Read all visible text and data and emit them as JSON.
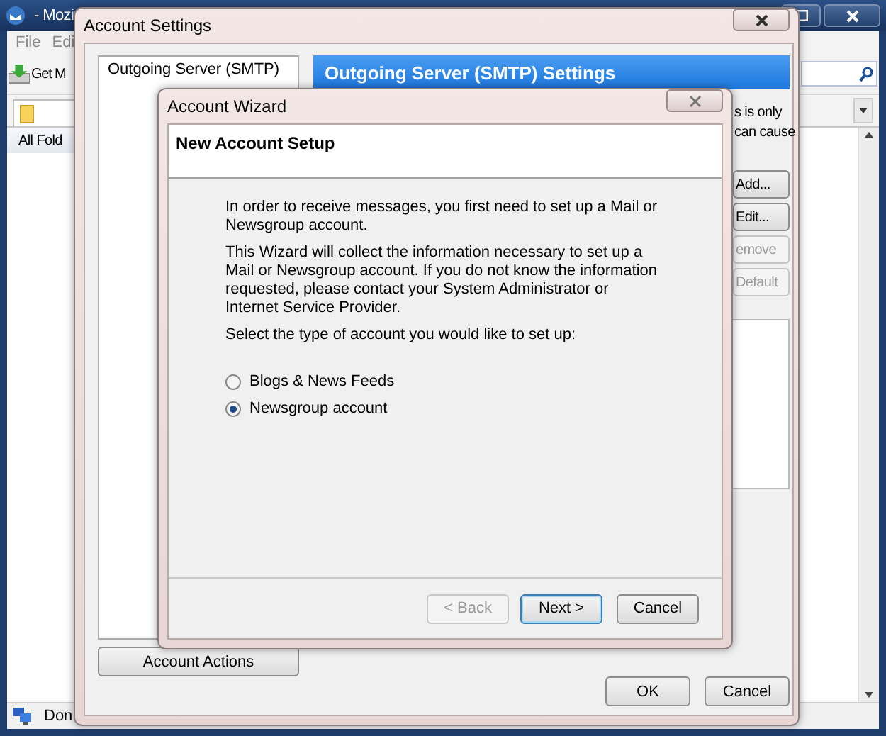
{
  "main_window": {
    "title": "- Mozi",
    "menu": [
      "File",
      "Edi"
    ],
    "toolbar_button": "Get M",
    "folder_pane_header": "All Fold",
    "status": "Don"
  },
  "account_settings": {
    "title": "Account Settings",
    "tree": [
      "Outgoing Server (SMTP)"
    ],
    "header": "Outgoing Server (SMTP) Settings",
    "description_lines": [
      "s is only",
      "can cause"
    ],
    "side_buttons": [
      {
        "label": "Add...",
        "disabled": false
      },
      {
        "label": "Edit...",
        "disabled": false
      },
      {
        "label": "emove",
        "disabled": true
      },
      {
        "label": "Default",
        "disabled": true
      }
    ],
    "account_actions": "Account Actions",
    "buttons": [
      "OK",
      "Cancel"
    ]
  },
  "wizard": {
    "title": "Account Wizard",
    "heading": "New Account Setup",
    "paragraphs": [
      "In order to receive messages, you first need to set up a Mail or Newsgroup account.",
      "This Wizard will collect the information necessary to set up a Mail or Newsgroup account. If you do not know the information requested, please contact your System Administrator or Internet Service Provider."
    ],
    "prompt": "Select the type of account you would like to set up:",
    "options": [
      {
        "label": "Blogs & News Feeds",
        "selected": false
      },
      {
        "label": "Newsgroup account",
        "selected": true
      }
    ],
    "buttons": [
      {
        "label": "< Back",
        "disabled": true,
        "focused": false
      },
      {
        "label": "Next >",
        "disabled": false,
        "focused": true
      },
      {
        "label": "Cancel",
        "disabled": false,
        "focused": false
      }
    ]
  }
}
